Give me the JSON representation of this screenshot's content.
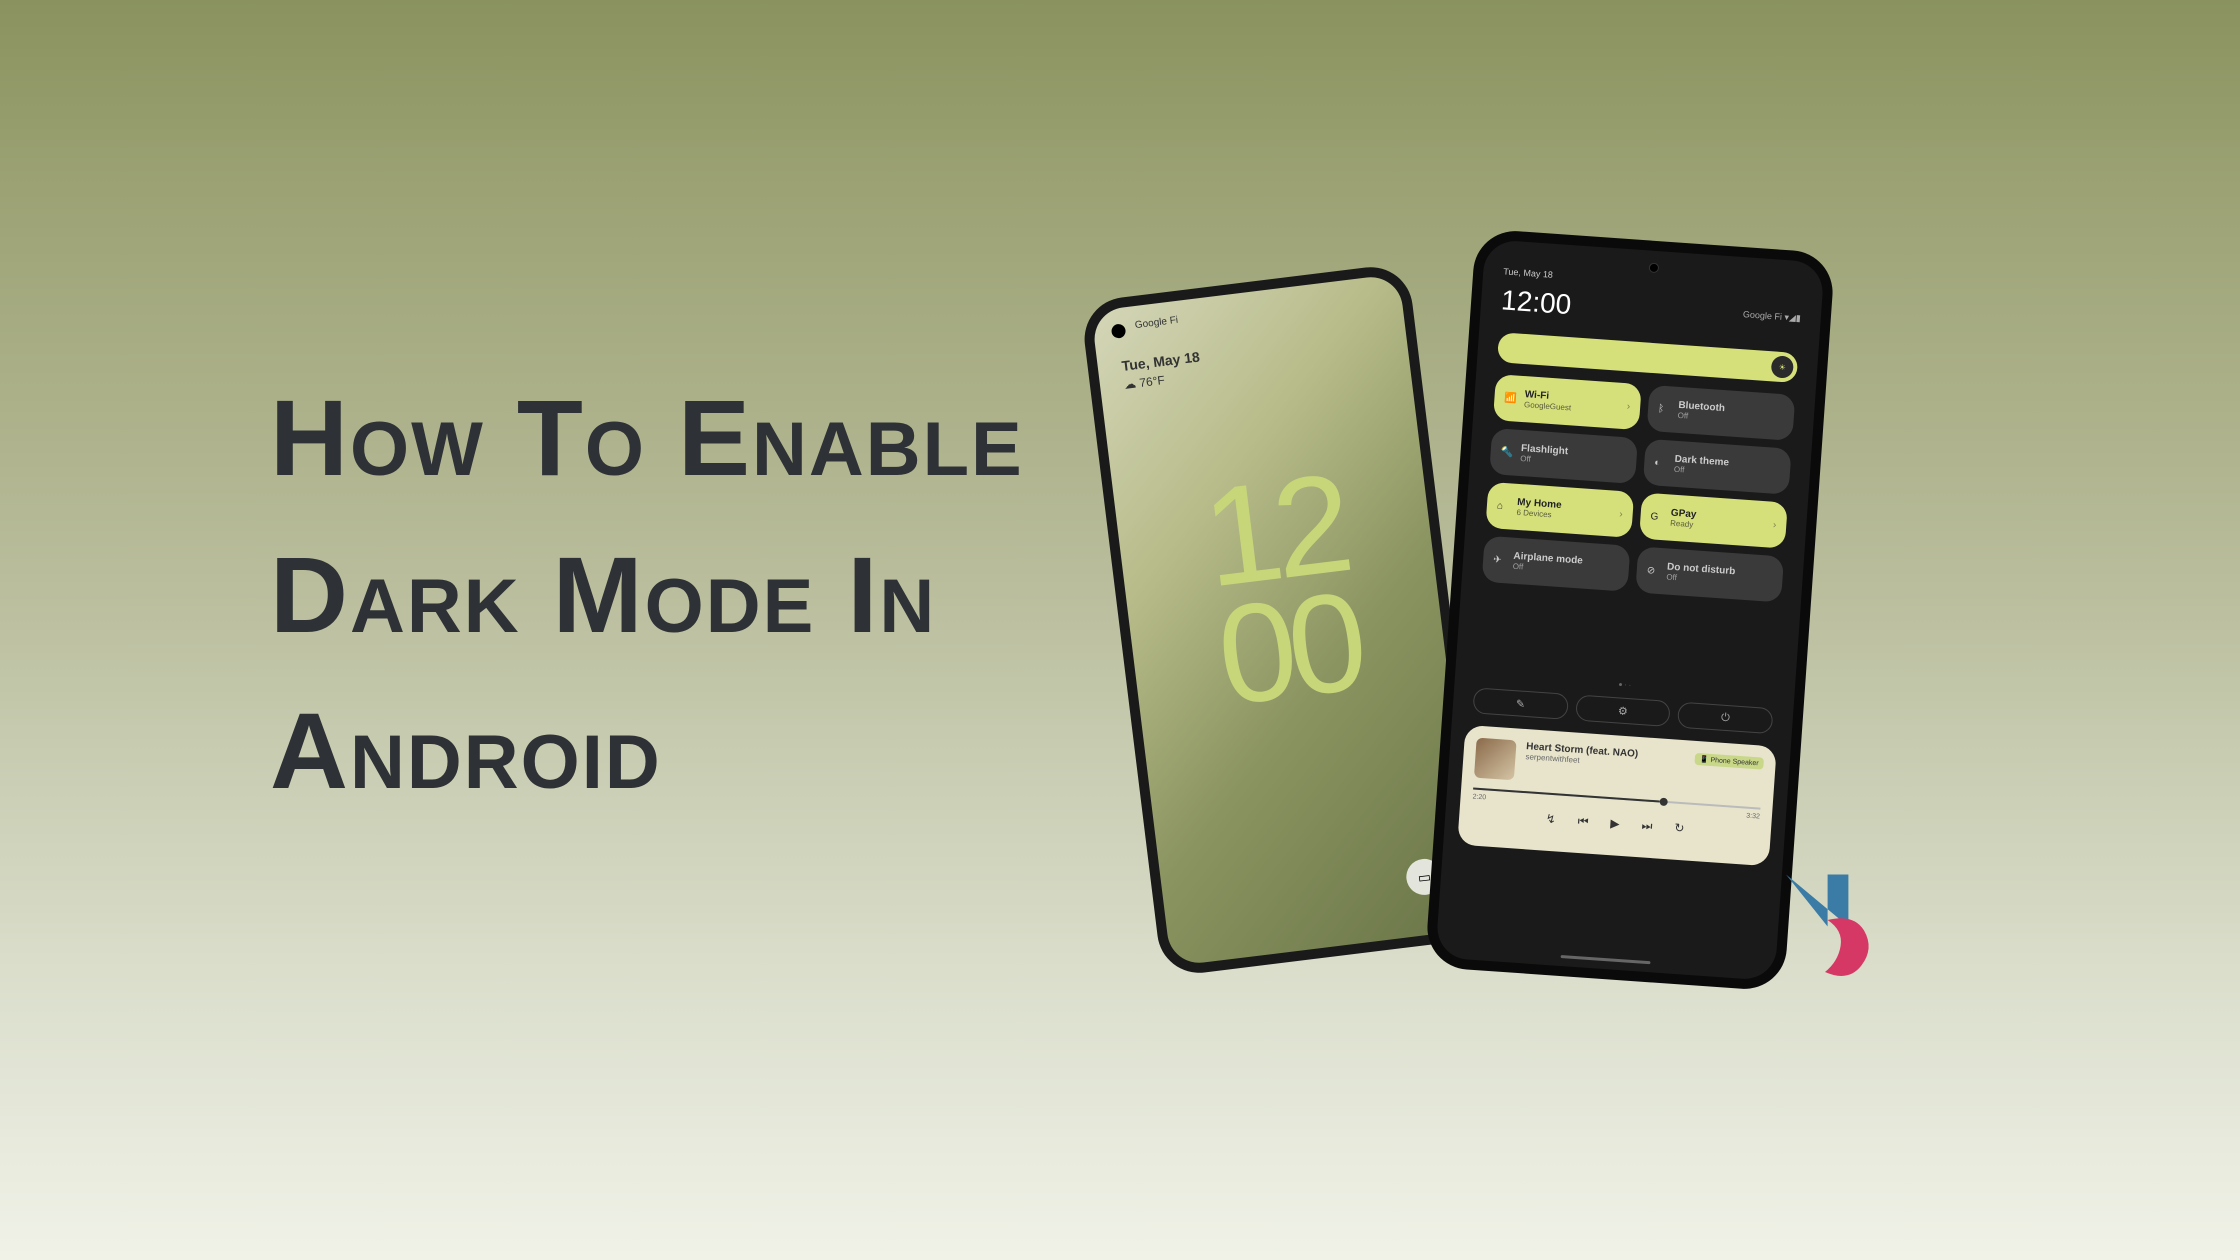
{
  "title_line1": "How To Enable",
  "title_line2": "Dark Mode In",
  "title_line3": "Android",
  "phone_left": {
    "carrier": "Google Fi",
    "date": "Tue, May 18",
    "temperature": "☁ 76°F",
    "clock_hours": "12",
    "clock_minutes": "00"
  },
  "phone_right": {
    "status_date": "Tue, May 18",
    "time": "12:00",
    "carrier": "Google Fi ▾◢▮",
    "tiles": [
      {
        "title": "Wi-Fi",
        "subtitle": "GoogleGuest",
        "icon": "📶",
        "active": true
      },
      {
        "title": "Bluetooth",
        "subtitle": "Off",
        "icon": "ᛒ",
        "active": false
      },
      {
        "title": "Flashlight",
        "subtitle": "Off",
        "icon": "🔦",
        "active": false
      },
      {
        "title": "Dark theme",
        "subtitle": "Off",
        "icon": "◐",
        "active": false
      },
      {
        "title": "My Home",
        "subtitle": "6 Devices",
        "icon": "⌂",
        "active": true
      },
      {
        "title": "GPay",
        "subtitle": "Ready",
        "icon": "G",
        "active": true
      },
      {
        "title": "Airplane mode",
        "subtitle": "Off",
        "icon": "✈",
        "active": false
      },
      {
        "title": "Do not disturb",
        "subtitle": "Off",
        "icon": "⊘",
        "active": false
      }
    ],
    "media": {
      "title": "Heart Storm (feat. NAO)",
      "artist": "serpentwithfeet",
      "badge": "📱 Phone Speaker",
      "time_current": "2:20",
      "time_total": "3:32"
    }
  }
}
